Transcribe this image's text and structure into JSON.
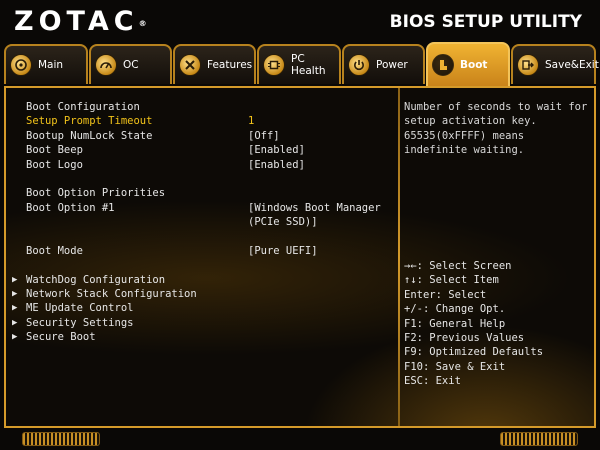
{
  "header": {
    "logo": "ZOTAC",
    "logo_mark": "®",
    "title": "BIOS SETUP UTILITY"
  },
  "tabs": [
    {
      "label": "Main",
      "icon": "disc-icon"
    },
    {
      "label": "OC",
      "icon": "gauge-icon"
    },
    {
      "label": "Features",
      "icon": "tools-icon"
    },
    {
      "label": "PC Health",
      "icon": "chip-icon"
    },
    {
      "label": "Power",
      "icon": "power-icon"
    },
    {
      "label": "Boot",
      "icon": "boot-icon",
      "active": true
    },
    {
      "label": "Save&Exit",
      "icon": "exit-icon"
    }
  ],
  "boot": {
    "section_config": "Boot Configuration",
    "setup_prompt_timeout": {
      "label": "Setup Prompt Timeout",
      "value": "1"
    },
    "numlock": {
      "label": "Bootup NumLock State",
      "value": "[Off]"
    },
    "beep": {
      "label": "Boot Beep",
      "value": "[Enabled]"
    },
    "logo": {
      "label": "Boot Logo",
      "value": "[Enabled]"
    },
    "section_priorities": "Boot Option Priorities",
    "option1": {
      "label": "Boot Option #1",
      "value_line1": "[Windows Boot Manager",
      "value_line2": "(PCIe SSD)]"
    },
    "mode": {
      "label": "Boot Mode",
      "value": "[Pure UEFI]"
    },
    "submenus": [
      "WatchDog Configuration",
      "Network Stack Configuration",
      "ME Update Control",
      "Security Settings",
      "Secure Boot"
    ]
  },
  "help": {
    "description": "Number of seconds to wait for setup activation key. 65535(0xFFFF) means indefinite waiting.",
    "keys": [
      "→←: Select Screen",
      "↑↓: Select Item",
      "Enter: Select",
      "+/-: Change Opt.",
      "F1: General Help",
      "F2: Previous Values",
      "F9: Optimized Defaults",
      "F10: Save & Exit",
      "ESC: Exit"
    ]
  },
  "colors": {
    "accent": "#d49a2a",
    "active_tab": "#e7a72c",
    "selected_text": "#f2c31a"
  }
}
